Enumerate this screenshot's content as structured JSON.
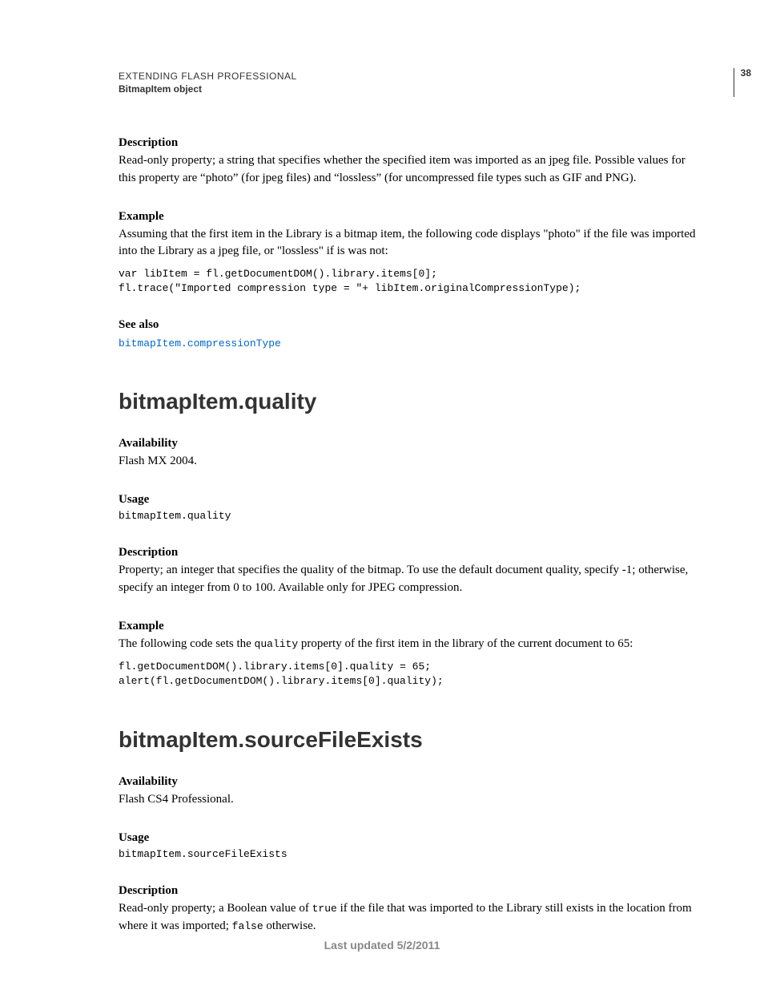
{
  "header": {
    "title": "EXTENDING FLASH PROFESSIONAL",
    "subtitle": "BitmapItem object",
    "page_number": "38"
  },
  "section1": {
    "desc_label": "Description",
    "desc_text": "Read-only property; a string that specifies whether the specified item was imported as an jpeg file. Possible values for this property are “photo” (for jpeg files) and “lossless” (for uncompressed file types such as GIF and PNG).",
    "example_label": "Example",
    "example_text": "Assuming that the first item in the Library is a bitmap item, the following code displays \"photo\" if the file was imported into the Library as a jpeg file, or \"lossless\" if is was not:",
    "example_code": "var libItem = fl.getDocumentDOM().library.items[0];\nfl.trace(\"Imported compression type = \"+ libItem.originalCompressionType);",
    "seealso_label": "See also",
    "seealso_link": "bitmapItem.compressionType"
  },
  "section2": {
    "heading": "bitmapItem.quality",
    "avail_label": "Availability",
    "avail_text": "Flash MX 2004.",
    "usage_label": "Usage",
    "usage_code": "bitmapItem.quality",
    "desc_label": "Description",
    "desc_text": "Property; an integer that specifies the quality of the bitmap. To use the default document quality, specify -1; otherwise, specify an integer from 0 to 100. Available only for JPEG compression.",
    "example_label": "Example",
    "example_text_pre": "The following code sets the ",
    "example_text_code": "quality",
    "example_text_post": " property of the first item in the library of the current document to 65:",
    "example_code": "fl.getDocumentDOM().library.items[0].quality = 65;\nalert(fl.getDocumentDOM().library.items[0].quality);"
  },
  "section3": {
    "heading": "bitmapItem.sourceFileExists",
    "avail_label": "Availability",
    "avail_text": "Flash CS4 Professional.",
    "usage_label": "Usage",
    "usage_code": "bitmapItem.sourceFileExists",
    "desc_label": "Description",
    "desc_text_pre": "Read-only property; a Boolean value of ",
    "desc_text_code1": "true",
    "desc_text_mid": " if the file that was imported to the Library still exists in the location from where it was imported; ",
    "desc_text_code2": "false",
    "desc_text_post": " otherwise."
  },
  "footer": {
    "text": "Last updated 5/2/2011"
  }
}
